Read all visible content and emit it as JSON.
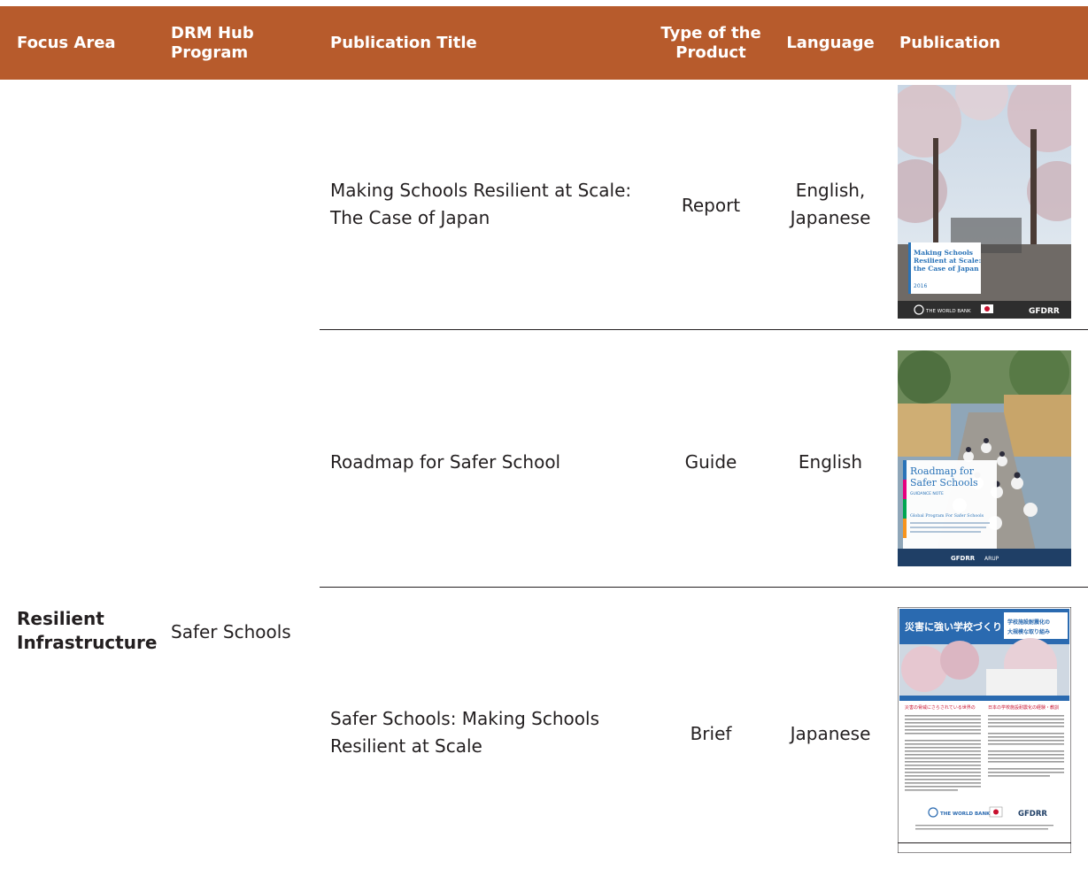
{
  "header": {
    "focus_area": "Focus Area",
    "drm_hub_program": "DRM Hub Program",
    "publication_title": "Publication Title",
    "type_of_product": "Type of the Product",
    "language": "Language",
    "publication": "Publication"
  },
  "group": {
    "focus_area": "Resilient Infrastructure",
    "program": "Safer Schools"
  },
  "rows": [
    {
      "title": "Making Schools Resilient at Scale: The Case of Japan",
      "type": "Report",
      "language": "English, Japanese",
      "cover": {
        "title": "Making Schools Resilient at Scale: the Case of Japan",
        "year": "2016",
        "publisher": "THE WORLD BANK",
        "partner": "GFDRR"
      }
    },
    {
      "title": "Roadmap for Safer School",
      "type": "Guide",
      "language": "English",
      "cover": {
        "title": "Roadmap for Safer Schools",
        "subtitle": "GUIDANCE NOTE",
        "program": "Global Program For Safer Schools",
        "partner": "GFDRR",
        "partner2": "ARUP"
      }
    },
    {
      "title": "Safer Schools: Making Schools Resilient at Scale",
      "type": "Brief",
      "language": "Japanese",
      "cover": {
        "title": "災害に強い学校づくり",
        "subtitle": "学校施設耐震化の大規模な取り組み",
        "publisher": "THE WORLD BANK",
        "partner": "GFDRR"
      }
    }
  ],
  "colors": {
    "header_bg": "#b75b2c",
    "header_text": "#ffffff",
    "body_text": "#231f20"
  }
}
